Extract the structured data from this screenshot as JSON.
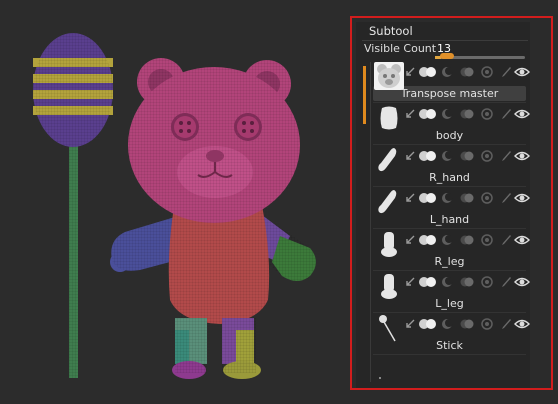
{
  "subtool": {
    "title": "Subtool",
    "visible_count_label": "Visible Count",
    "visible_count_value": "13",
    "items": [
      {
        "name": "Transpose master",
        "thumb": "bear-thumbnail",
        "selected": true
      },
      {
        "name": "body",
        "thumb": "body-thumbnail",
        "selected": false
      },
      {
        "name": "R_hand",
        "thumb": "hand-thumbnail",
        "selected": false
      },
      {
        "name": "L_hand",
        "thumb": "hand-thumbnail",
        "selected": false
      },
      {
        "name": "R_leg",
        "thumb": "leg-thumbnail",
        "selected": false
      },
      {
        "name": "L_leg",
        "thumb": "leg-thumbnail",
        "selected": false
      },
      {
        "name": "Stick",
        "thumb": "stick-thumbnail",
        "selected": false
      }
    ]
  },
  "colors": {
    "highlight": "#d21d1d",
    "accent": "#e08a1e",
    "bear_pink": "#b2447a",
    "body_red": "#b24a4a",
    "arm_blue": "#4a4f9a",
    "arm_purple": "#6d4a9b",
    "hand_green": "#3c7a3a",
    "stick_green": "#3f7d4e",
    "lollipop_purple": "#5a3f8e",
    "lollipop_yellow": "#b3a33c"
  }
}
